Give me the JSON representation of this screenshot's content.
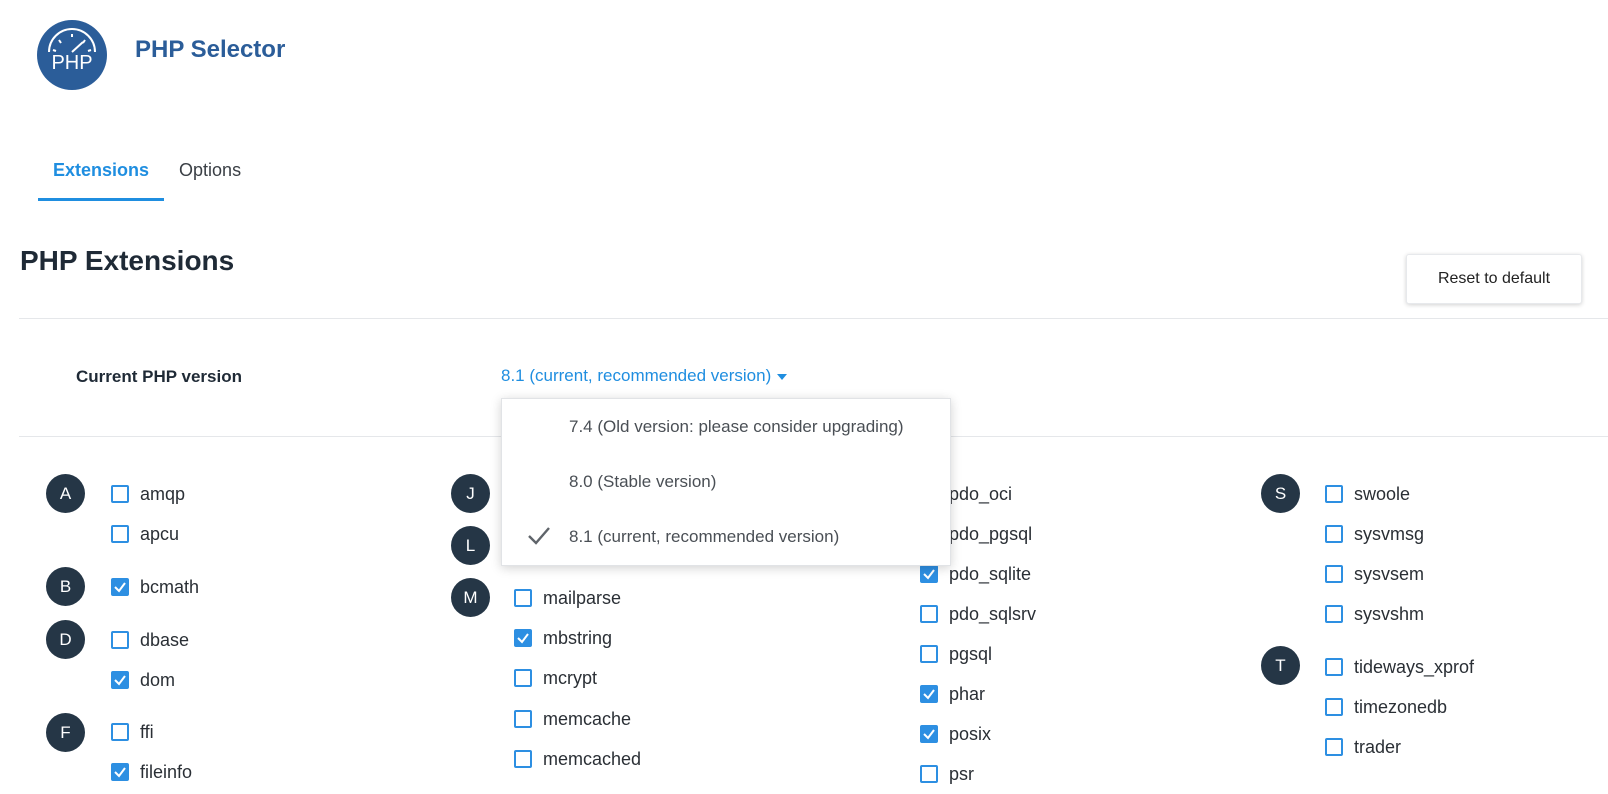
{
  "header": {
    "logo_text": "PHP",
    "title": "PHP Selector"
  },
  "tabs": [
    {
      "label": "Extensions",
      "active": true
    },
    {
      "label": "Options",
      "active": false
    }
  ],
  "section": {
    "title": "PHP Extensions",
    "reset_label": "Reset to default"
  },
  "version": {
    "label": "Current PHP version",
    "selected": "8.1 (current, recommended version)",
    "options": [
      {
        "label": "7.4 (Old version: please consider upgrading)",
        "selected": false
      },
      {
        "label": "8.0 (Stable version)",
        "selected": false
      },
      {
        "label": "8.1 (current, recommended version)",
        "selected": true
      }
    ]
  },
  "letters": [
    "A",
    "B",
    "D",
    "F",
    "J",
    "L",
    "M",
    "S",
    "T"
  ],
  "extensions": [
    {
      "name": "amqp",
      "checked": false
    },
    {
      "name": "apcu",
      "checked": false
    },
    {
      "name": "bcmath",
      "checked": true
    },
    {
      "name": "dbase",
      "checked": false
    },
    {
      "name": "dom",
      "checked": true
    },
    {
      "name": "ffi",
      "checked": false
    },
    {
      "name": "fileinfo",
      "checked": true
    },
    {
      "name": "mailparse",
      "checked": false
    },
    {
      "name": "mbstring",
      "checked": true
    },
    {
      "name": "mcrypt",
      "checked": false
    },
    {
      "name": "memcache",
      "checked": false
    },
    {
      "name": "memcached",
      "checked": false
    },
    {
      "name": "pdo_oci",
      "checked": false
    },
    {
      "name": "pdo_pgsql",
      "checked": false
    },
    {
      "name": "pdo_sqlite",
      "checked": true
    },
    {
      "name": "pdo_sqlsrv",
      "checked": false
    },
    {
      "name": "pgsql",
      "checked": false
    },
    {
      "name": "phar",
      "checked": true
    },
    {
      "name": "posix",
      "checked": true
    },
    {
      "name": "psr",
      "checked": false
    },
    {
      "name": "swoole",
      "checked": false
    },
    {
      "name": "sysvmsg",
      "checked": false
    },
    {
      "name": "sysvsem",
      "checked": false
    },
    {
      "name": "sysvshm",
      "checked": false
    },
    {
      "name": "tideways_xprof",
      "checked": false
    },
    {
      "name": "timezonedb",
      "checked": false
    },
    {
      "name": "trader",
      "checked": false
    }
  ],
  "colors": {
    "accent": "#1f8ee0",
    "brand": "#2b5d99",
    "letter_badge": "#253646",
    "checkbox": "#2d8fe2"
  }
}
